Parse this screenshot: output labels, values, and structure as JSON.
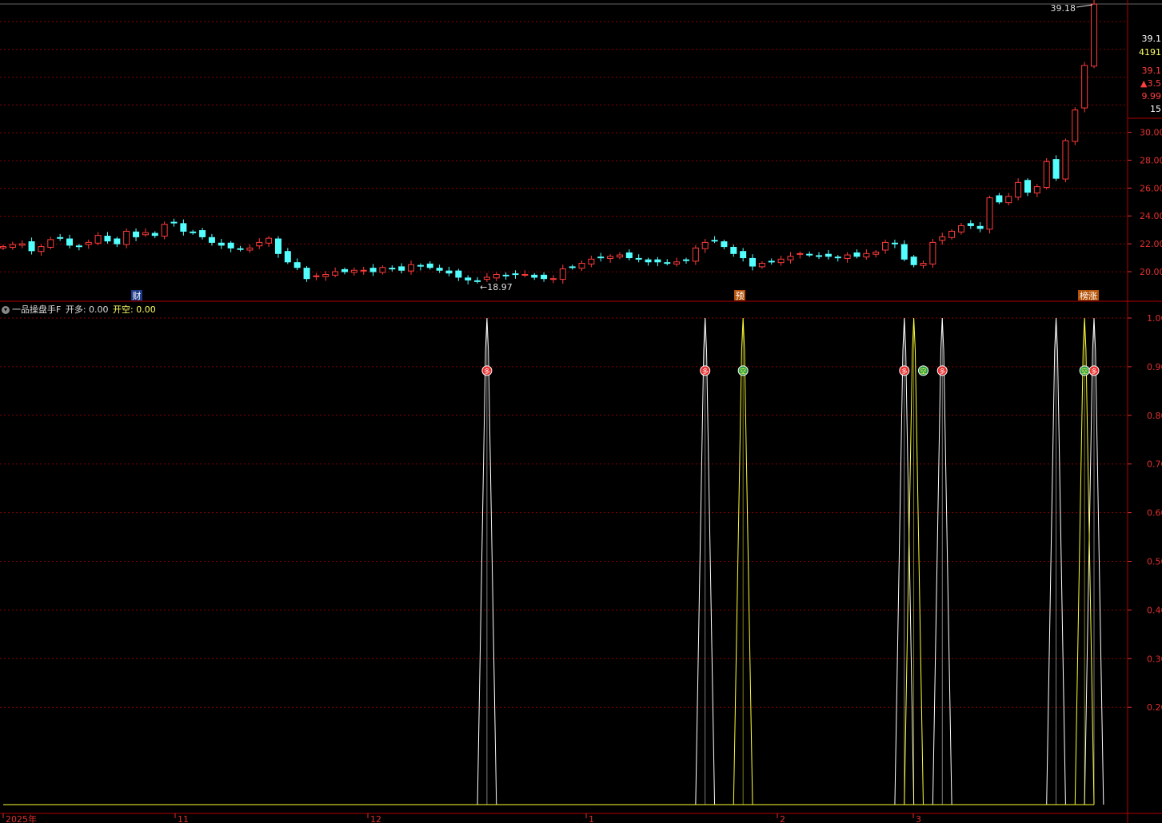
{
  "indicator": {
    "name": "一品操盘手F",
    "series_a_label": "开多:",
    "series_a_value": "0.00",
    "series_b_label": "开空:",
    "series_b_value": "0.00",
    "collapse_icon": "chevron-down-icon"
  },
  "price_panel": {
    "high_marker": "39.18",
    "low_marker": "←18.97",
    "event_labels": [
      "财",
      "预",
      "榜涨"
    ],
    "right_info": [
      "39.1",
      "4191",
      "39.1",
      "▲3.5",
      "9.99",
      "15"
    ]
  },
  "colors": {
    "up": "#ff3b3b",
    "down": "#54ffff",
    "grid": "#8b0000",
    "series_a": "#ffffff",
    "series_b": "#ffff33",
    "axis_text": "#e03030"
  },
  "chart_data": [
    {
      "type": "candlestick",
      "title": "",
      "y_ticks": [
        "30.00",
        "28.00",
        "26.00",
        "24.00",
        "22.00",
        "20.00"
      ],
      "x_ticks": [
        "2025年",
        "11",
        "12",
        "1",
        "2",
        "3"
      ],
      "closes": [
        21.8,
        21.95,
        22.0,
        21.5,
        21.8,
        22.3,
        22.4,
        21.9,
        21.8,
        22.1,
        22.6,
        22.2,
        22.0,
        22.9,
        22.5,
        22.8,
        22.6,
        23.4,
        23.5,
        22.9,
        22.8,
        22.5,
        22.1,
        21.9,
        21.7,
        21.6,
        21.7,
        22.1,
        22.4,
        21.3,
        20.7,
        20.3,
        19.5,
        19.7,
        19.8,
        20.0,
        20.0,
        20.1,
        20.1,
        20.0,
        20.3,
        20.2,
        20.1,
        20.5,
        20.4,
        20.3,
        20.1,
        19.9,
        19.6,
        19.4,
        19.3,
        19.6,
        19.8,
        19.7,
        19.8,
        19.8,
        19.6,
        19.5,
        19.5,
        20.2,
        20.3,
        20.6,
        20.9,
        21.0,
        21.1,
        21.2,
        21.0,
        20.9,
        20.7,
        20.7,
        20.6,
        20.7,
        20.8,
        21.7,
        22.1,
        22.2,
        21.8,
        21.3,
        21.0,
        20.4,
        20.6,
        20.7,
        20.9,
        21.1,
        21.3,
        21.2,
        21.1,
        21.1,
        21.0,
        21.2,
        21.1,
        21.3,
        21.4,
        22.1,
        22.0,
        20.9,
        20.5,
        20.6,
        22.1,
        22.5,
        22.9,
        23.3,
        23.3,
        23.1,
        25.3,
        25.0,
        25.4,
        26.4,
        25.7,
        26.1,
        27.9,
        26.7,
        29.4,
        31.6,
        34.8,
        39.2
      ]
    },
    {
      "type": "line",
      "title": "",
      "y_ticks": [
        "1.00",
        "0.90",
        "0.80",
        "0.70",
        "0.60",
        "0.50",
        "0.40",
        "0.30",
        "0.20"
      ],
      "ylim": [
        0,
        1
      ],
      "series": [
        {
          "name": "开多",
          "peaks_at_index": [
            51,
            74,
            95,
            99,
            111,
            115
          ]
        },
        {
          "name": "开空",
          "peaks_at_index": [
            78,
            96,
            114
          ]
        }
      ],
      "signal_markers": [
        {
          "index": 51,
          "label": "多",
          "value": 0.9
        },
        {
          "index": 74,
          "label": "多",
          "value": 0.9
        },
        {
          "index": 78,
          "label": "空",
          "value": 0.9
        },
        {
          "index": 95,
          "label": "多",
          "value": 0.9
        },
        {
          "index": 97,
          "label": "空",
          "value": 0.9
        },
        {
          "index": 99,
          "label": "多",
          "value": 0.9
        },
        {
          "index": 114,
          "label": "空",
          "value": 0.9
        },
        {
          "index": 115,
          "label": "多",
          "value": 0.9
        }
      ]
    }
  ]
}
